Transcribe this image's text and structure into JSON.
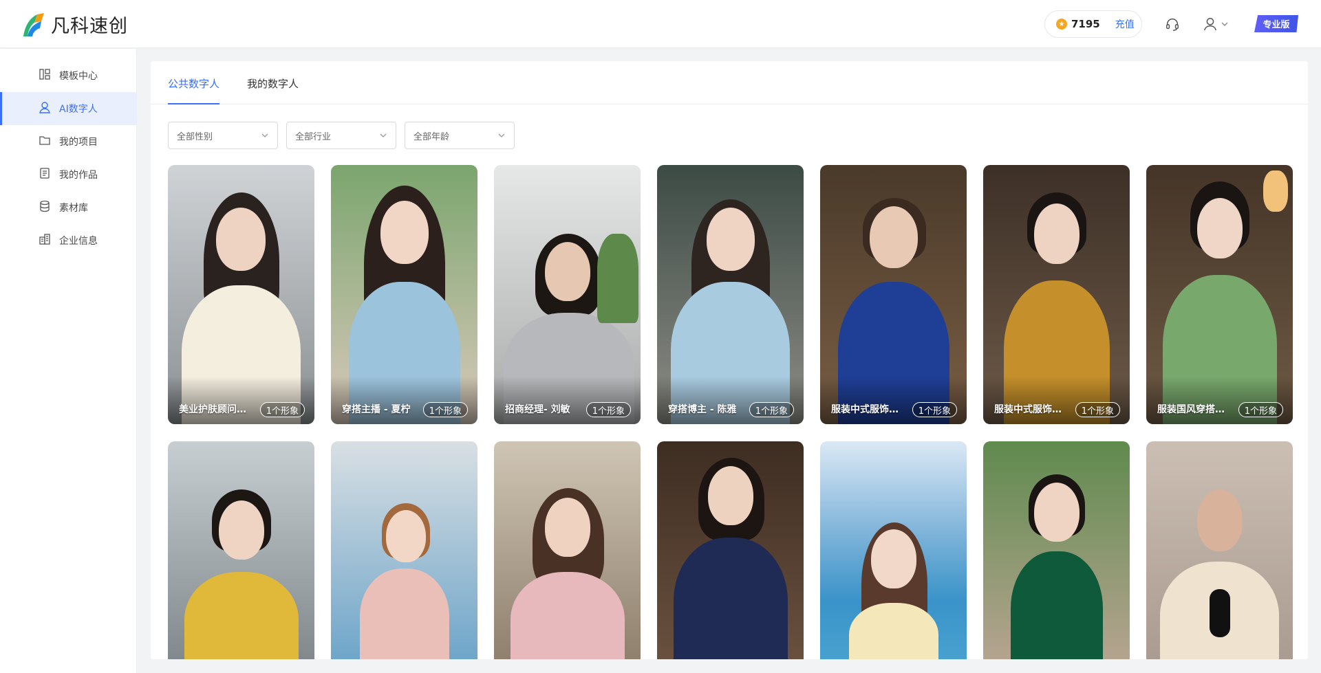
{
  "header": {
    "logo_text": "凡科速创",
    "points": "7195",
    "recharge_label": "充值",
    "pro_badge": "专业版"
  },
  "sidebar": {
    "items": [
      {
        "label": "模板中心",
        "icon": "template-icon"
      },
      {
        "label": "AI数字人",
        "icon": "user-icon"
      },
      {
        "label": "我的项目",
        "icon": "folder-icon"
      },
      {
        "label": "我的作品",
        "icon": "document-icon"
      },
      {
        "label": "素材库",
        "icon": "database-icon"
      },
      {
        "label": "企业信息",
        "icon": "building-icon"
      }
    ],
    "active_index": 1
  },
  "tabs": [
    {
      "label": "公共数字人",
      "active": true
    },
    {
      "label": "我的数字人",
      "active": false
    }
  ],
  "filters": [
    {
      "value": "全部性别"
    },
    {
      "value": "全部行业"
    },
    {
      "value": "全部年龄"
    }
  ],
  "cards": [
    {
      "label": "美业护肤顾问…",
      "count": "1个形象"
    },
    {
      "label": "穿搭主播 - 夏柠",
      "count": "1个形象"
    },
    {
      "label": "招商经理- 刘敏",
      "count": "1个形象"
    },
    {
      "label": "穿搭博主 - 陈雅",
      "count": "1个形象"
    },
    {
      "label": "服装中式服饰…",
      "count": "1个形象"
    },
    {
      "label": "服装中式服饰…",
      "count": "1个形象"
    },
    {
      "label": "服装国风穿搭…",
      "count": "1个形象"
    },
    {
      "label": "",
      "count": ""
    },
    {
      "label": "",
      "count": ""
    },
    {
      "label": "",
      "count": ""
    },
    {
      "label": "",
      "count": ""
    },
    {
      "label": "",
      "count": ""
    },
    {
      "label": "",
      "count": ""
    },
    {
      "label": "",
      "count": ""
    }
  ],
  "colors": {
    "accent": "#3a6ff7",
    "active_nav_bg": "#e9effd",
    "coin": "#f5a623"
  }
}
